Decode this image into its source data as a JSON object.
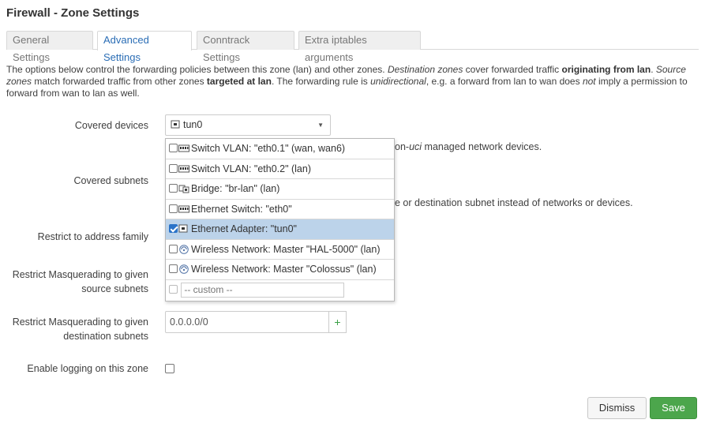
{
  "page": {
    "title": "Firewall - Zone Settings"
  },
  "tabs": [
    {
      "label": "General Settings",
      "active": false
    },
    {
      "label": "Advanced Settings",
      "active": true
    },
    {
      "label": "Conntrack Settings",
      "active": false
    },
    {
      "label": "Extra iptables arguments",
      "active": false
    }
  ],
  "description": {
    "p1": "The options below control the forwarding policies between this zone (lan) and other zones. ",
    "p2": "Destination zones",
    "p3": " cover forwarded traffic ",
    "p4": "originating from lan",
    "p5": ". ",
    "p6": "Source zones",
    "p7": " match forwarded traffic from other zones ",
    "p8": "targeted at lan",
    "p9": ". The forwarding rule is ",
    "p10": "unidirectional",
    "p11": ", e.g. a forward from lan to wan does ",
    "p12": "not",
    "p13": " imply a permission to forward from wan to lan as well."
  },
  "fields": {
    "covered_devices": {
      "label": "Covered devices",
      "value": "tun0",
      "hint_prefix": "on-",
      "hint_em": "uci",
      "hint_suffix": " managed network devices."
    },
    "covered_subnets": {
      "label": "Covered subnets",
      "hint": "e or destination subnet instead of networks or devices."
    },
    "address_family": {
      "label": "Restrict to address family"
    },
    "masq_src": {
      "label_l1": "Restrict Masquerading to given",
      "label_l2": "source subnets"
    },
    "masq_dest": {
      "label_l1": "Restrict Masquerading to given",
      "label_l2": "destination subnets",
      "value": "0.0.0.0/0",
      "add_label": "+"
    },
    "logging": {
      "label": "Enable logging on this zone",
      "checked": false
    }
  },
  "dropdown": {
    "options": [
      {
        "label": "Switch VLAN: \"eth0.1\" (wan, wan6)",
        "icon": "switch-icon",
        "checked": false
      },
      {
        "label": "Switch VLAN: \"eth0.2\" (lan)",
        "icon": "switch-icon",
        "checked": false
      },
      {
        "label": "Bridge: \"br-lan\" (lan)",
        "icon": "bridge-icon",
        "checked": false
      },
      {
        "label": "Ethernet Switch: \"eth0\"",
        "icon": "switch-icon",
        "checked": false
      },
      {
        "label": "Ethernet Adapter: \"tun0\"",
        "icon": "ethernet-icon",
        "checked": true
      },
      {
        "label": "Wireless Network: Master \"HAL-5000\" (lan)",
        "icon": "wifi-icon",
        "checked": false
      },
      {
        "label": "Wireless Network: Master \"Colossus\" (lan)",
        "icon": "wifi-icon",
        "checked": false
      }
    ],
    "custom_placeholder": "-- custom --"
  },
  "buttons": {
    "dismiss": "Dismiss",
    "save": "Save"
  },
  "colors": {
    "accent": "#2a6db5",
    "save": "#4ca64c",
    "selected_row": "#bcd3ea"
  }
}
